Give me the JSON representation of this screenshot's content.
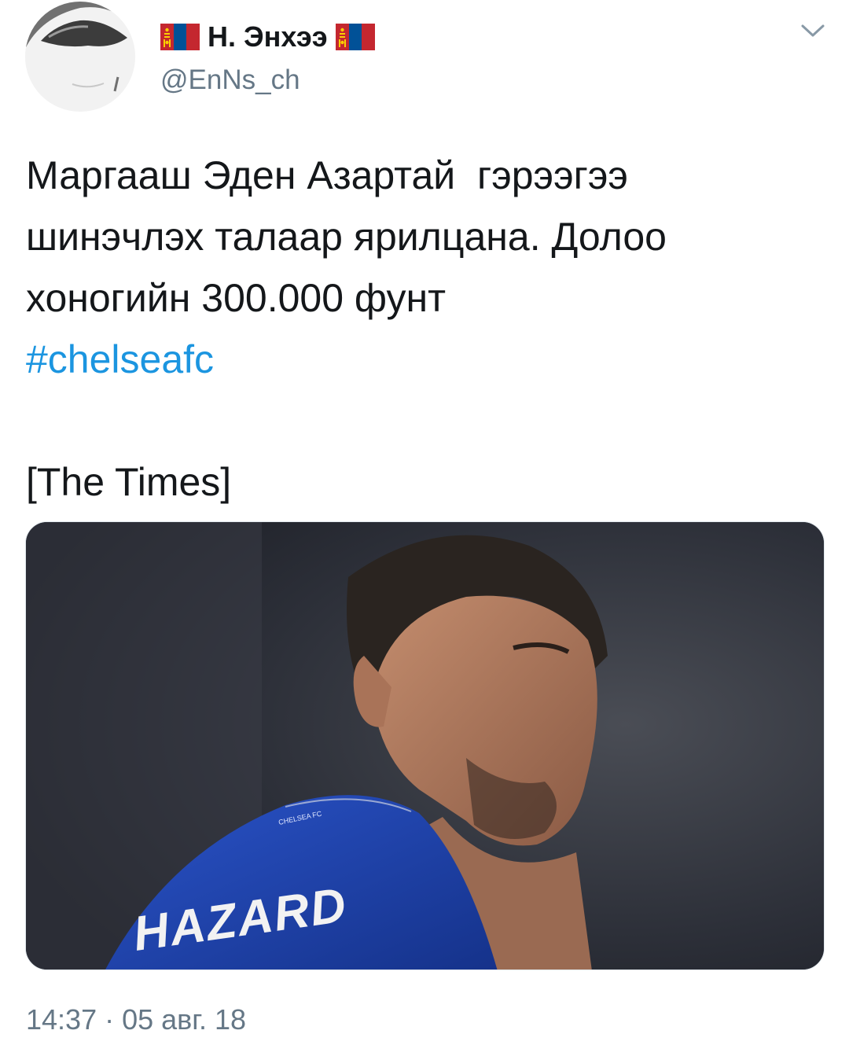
{
  "author": {
    "display_name": "Н. Энхээ",
    "handle": "@EnNs_ch",
    "flag_icon": "mongolia-flag-icon",
    "flag_colors": {
      "red": "#c4272f",
      "blue": "#015197",
      "gold": "#f9cf02"
    }
  },
  "tweet": {
    "lines": [
      "Маргааш Эден Азартай  гэрээгээ",
      "шинэчлэх талаар ярилцана. Долоо",
      "хоногийн 300.000 фунт"
    ],
    "hashtag": "#chelseafc",
    "source": "[The Times]"
  },
  "media": {
    "jersey_crest": "CHELSEA FC",
    "jersey_name": "HAZARD",
    "kit_color": "#1b3fa8"
  },
  "meta": {
    "timestamp": "14:37 · 05 авг. 18"
  },
  "colors": {
    "text": "#14171a",
    "secondary": "#657786",
    "link": "#1b95e0"
  }
}
